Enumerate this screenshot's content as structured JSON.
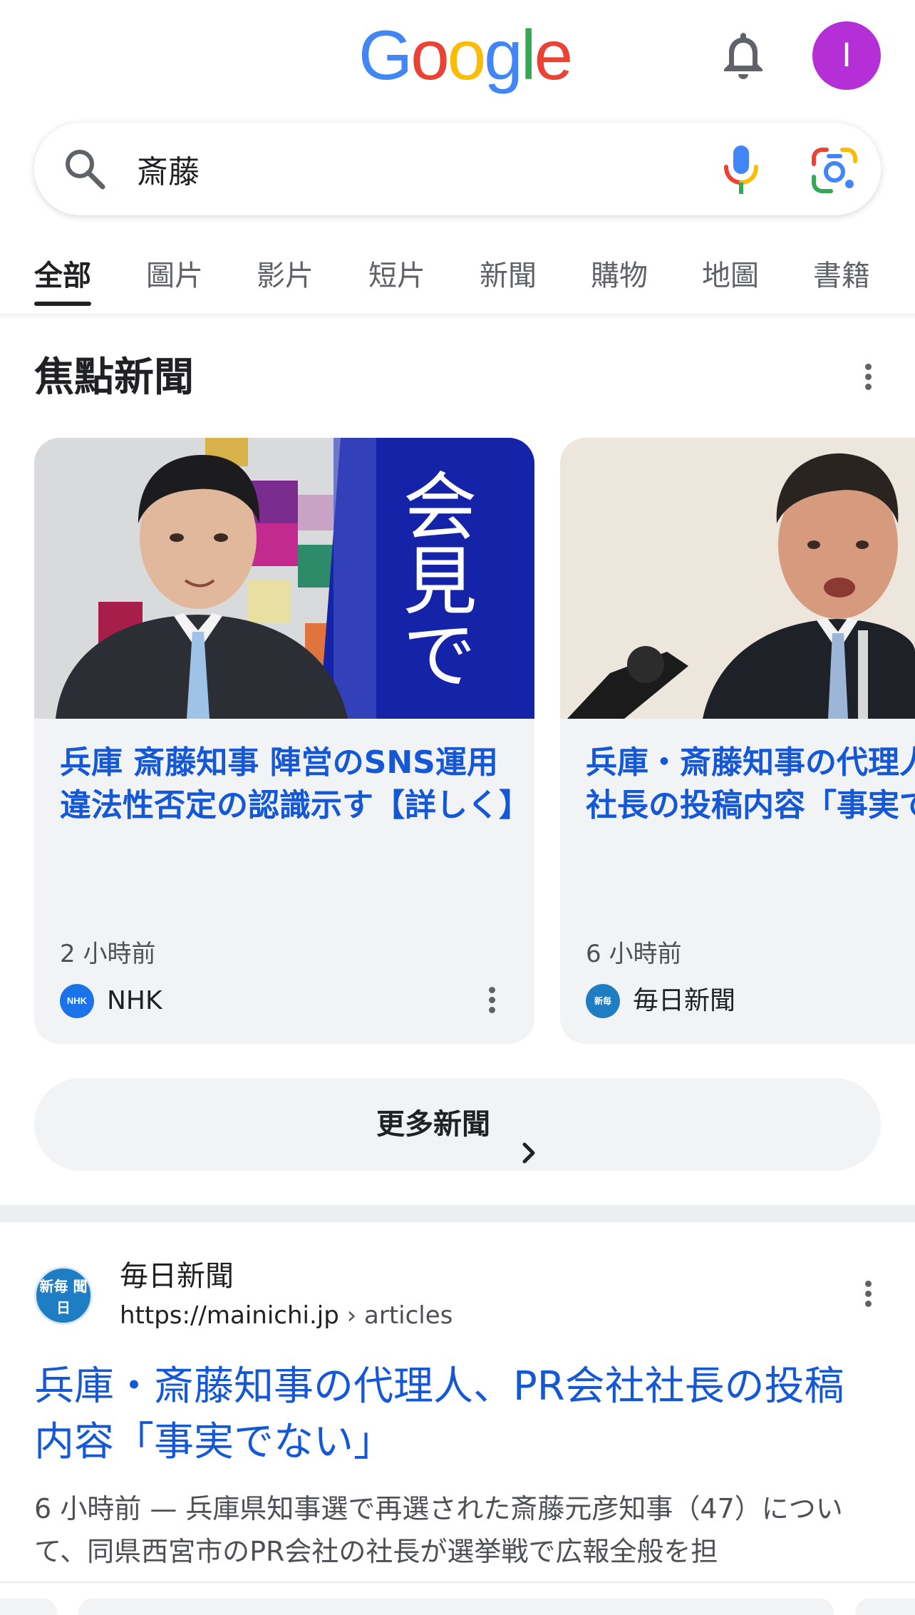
{
  "header": {
    "logo_text": "Google",
    "logo_colors": [
      "#4285F4",
      "#EA4335",
      "#FBBC05",
      "#4285F4",
      "#34A853",
      "#EA4335"
    ],
    "avatar_initial": "I",
    "avatar_color": "#b52fd6"
  },
  "search": {
    "query": "斎藤"
  },
  "tabs": [
    {
      "label": "全部",
      "active": true
    },
    {
      "label": "圖片"
    },
    {
      "label": "影片"
    },
    {
      "label": "短片"
    },
    {
      "label": "新聞"
    },
    {
      "label": "購物"
    },
    {
      "label": "地圖"
    },
    {
      "label": "書籍"
    }
  ],
  "top_stories": {
    "title": "焦點新聞",
    "cards": [
      {
        "image_overlay": "会見で",
        "headline": "兵庫 斎藤知事 陣営のSNS運用 違法性否定の認識示す【詳しく】",
        "time": "2 小時前",
        "source": "NHK",
        "source_logo": "NHK"
      },
      {
        "headline": "兵庫・斎藤知事の代理人、PR会社社長の投稿内容「事実でない」",
        "time": "6 小時前",
        "source": "毎日新聞",
        "source_logo": "新毎"
      }
    ],
    "more_label": "更多新聞"
  },
  "result": {
    "site_name": "毎日新聞",
    "logo_text": "新毎 聞日",
    "url": "https://mainichi.jp",
    "url_path": " › articles",
    "title": "兵庫・斎藤知事の代理人、PR会社社長の投稿内容「事実でない」",
    "snippet_time": "6 小時前",
    "snippet": " — 兵庫県知事選で再選された斎藤元彦知事（47）について、同県西宮市のPR会社の社長が選挙戦で広報全般を担"
  }
}
